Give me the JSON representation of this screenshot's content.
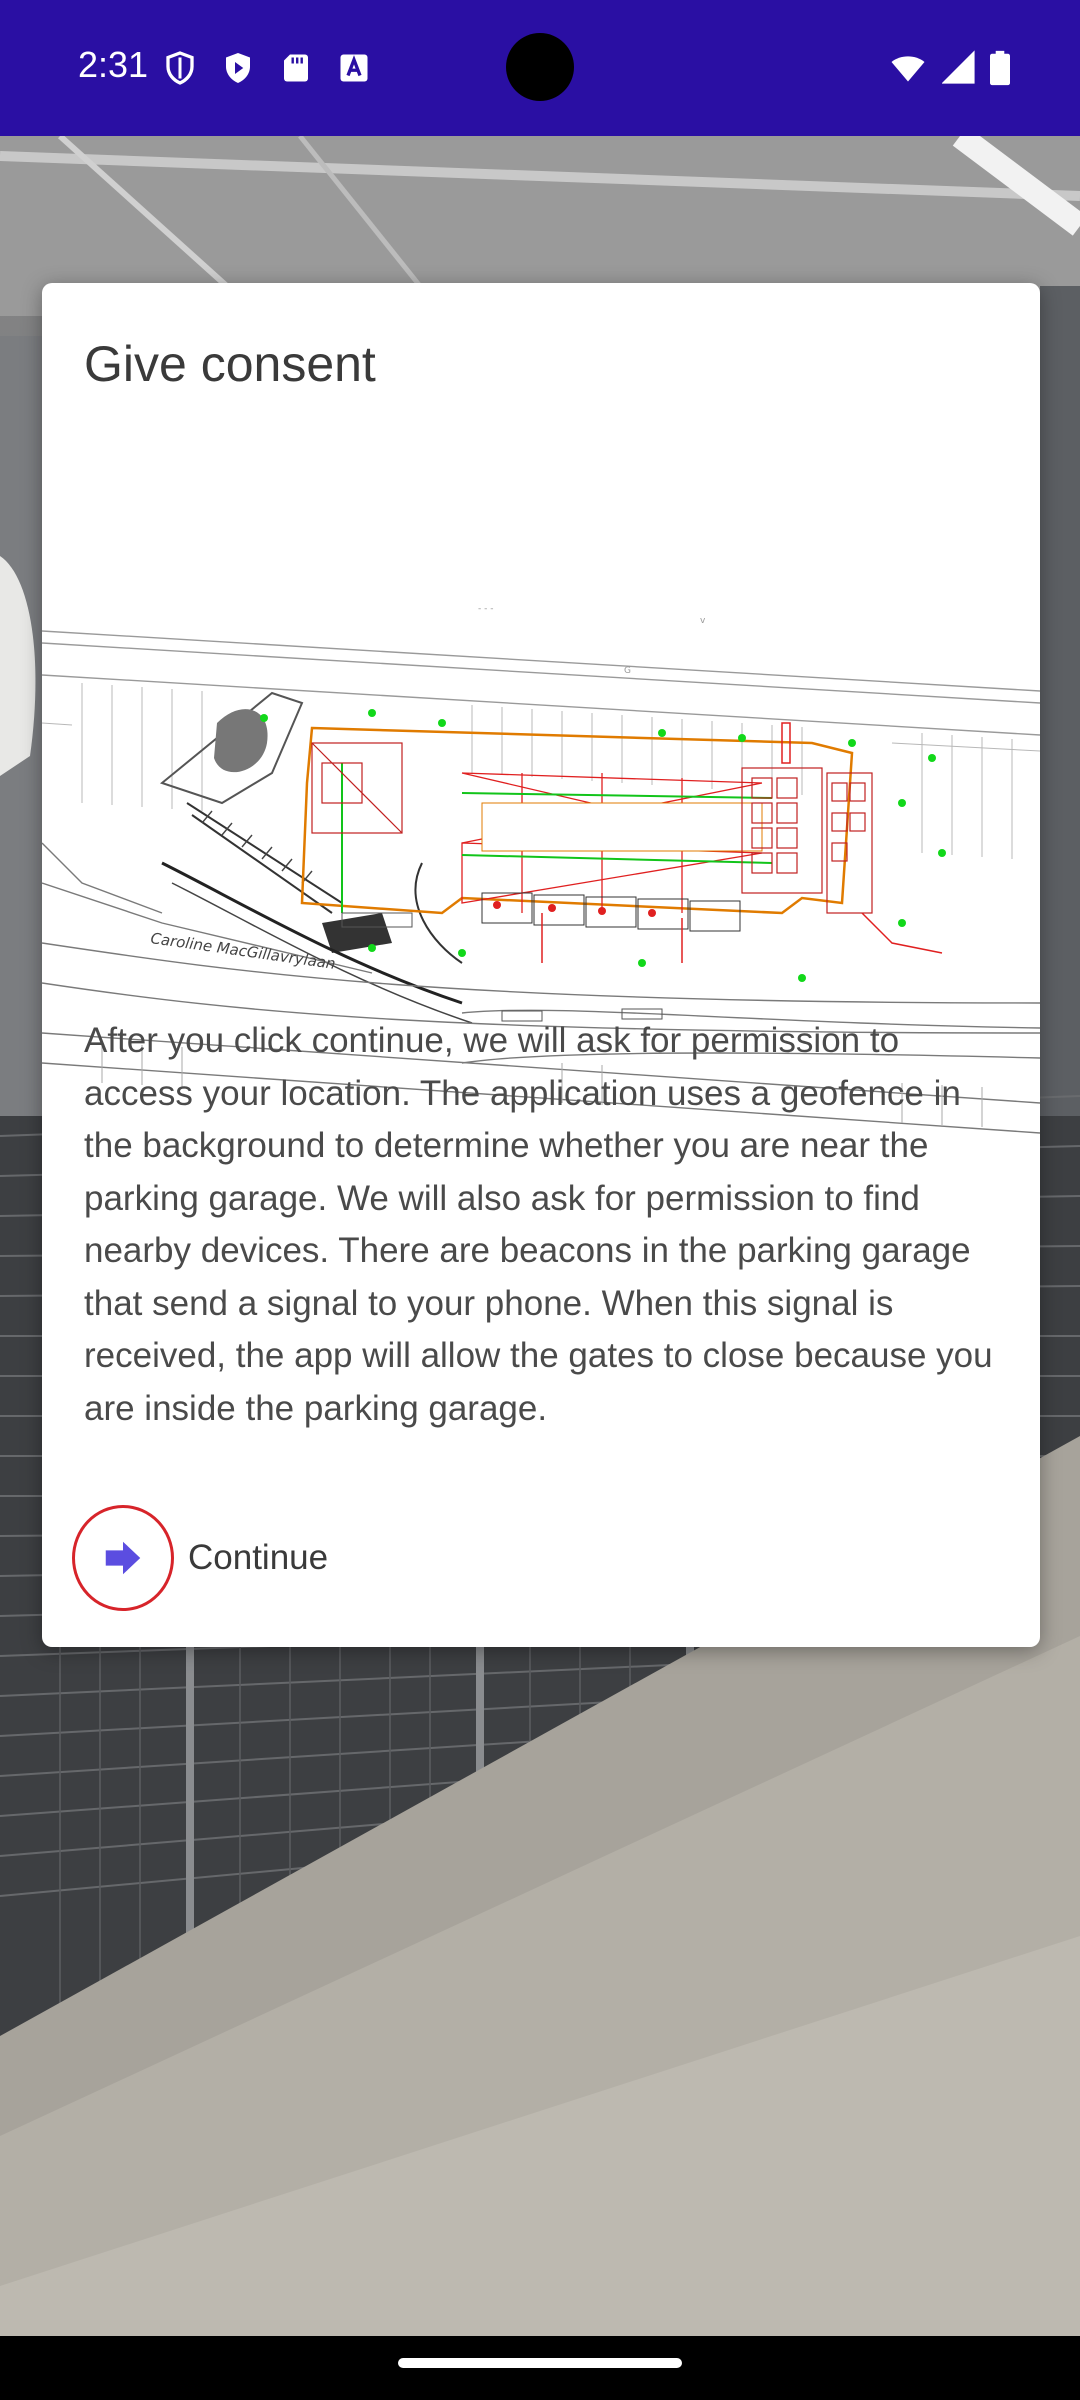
{
  "status_bar": {
    "time": "2:31",
    "background_color": "#2a0fa3",
    "left_icons": [
      "shield-outline-icon",
      "play-shield-icon",
      "sd-card-icon",
      "font-a-icon"
    ],
    "right_icons": [
      "wifi-icon",
      "cellular-signal-icon",
      "battery-icon"
    ]
  },
  "dialog": {
    "title": "Give consent",
    "image": {
      "name": "parking-garage-floorplan",
      "street_label": "Caroline MacGillavrylaan"
    },
    "body": "After you click continue, we will ask for permission to access your location. The application uses a geofence in the background to determine whether you are near the parking garage. We will also ask for permission to find nearby devices. There are beacons in the parking garage that send a signal to your phone. When this signal is received, the app will allow the gates to close because you are inside the parking garage.",
    "continue_button": {
      "label": "Continue",
      "icon": "arrow-right-icon",
      "icon_color": "#5b4de0",
      "highlight_color": "#d7242a"
    }
  },
  "background": {
    "description_icon": "parking-garage-photo"
  }
}
